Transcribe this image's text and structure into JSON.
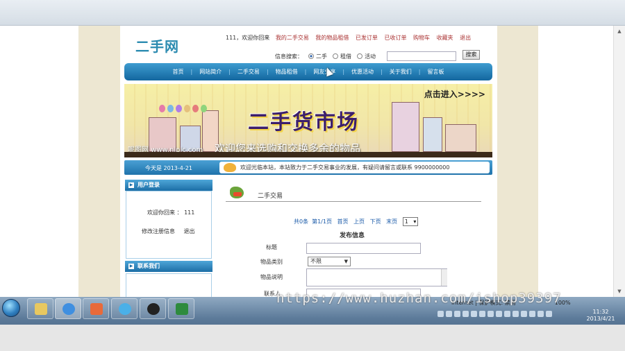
{
  "site": {
    "logo": "二手网",
    "top_links": {
      "welcome": "111，欢迎你回来",
      "items": [
        "我的二手交易",
        "我的物品租借",
        "已发订单",
        "已收订单",
        "购物车",
        "收藏夹",
        "退出"
      ]
    },
    "search": {
      "label": "信息搜索：",
      "options": [
        "二手",
        "租借",
        "活动"
      ],
      "selected": "二手",
      "button": "搜索"
    },
    "nav": [
      "首页",
      "网站简介",
      "二手交易",
      "物品租借",
      "网友分享",
      "优惠活动",
      "关于我们",
      "留言板"
    ],
    "banner": {
      "title": "二手货市场",
      "cta": "点击进入>>>>",
      "slogan": "欢迎您来选购和交换多余的物品",
      "credit": "呢图网 www.nipic.com"
    },
    "info_bar": {
      "date": "今天是 2013-4-21",
      "notice": "欢迎光临本站，本站致力于二手交易事业的发展，有疑问请留言或联系 9900000000"
    },
    "login_panel": {
      "title": "用户登录",
      "welcome": "欢迎你回来 ： 111",
      "links": [
        "修改注册信息",
        "退出"
      ]
    },
    "contact_panel": {
      "title": "联系我们"
    },
    "content": {
      "section_title": "二手交易",
      "pager": {
        "total": "共0条",
        "page": "第1/1页",
        "first": "首页",
        "prev": "上页",
        "next": "下页",
        "last": "末页",
        "select_value": "1"
      },
      "form_heading": "发布信息",
      "fields": {
        "title_label": "标题",
        "category_label": "物品类别",
        "category_value": "不限",
        "desc_label": "物品说明",
        "contact_label": "联系人"
      }
    }
  },
  "taskbar": {
    "time": "11:32",
    "date": "2013/4/21",
    "status": "Internet | 保护模式: 禁用",
    "zoom": "100%"
  },
  "watermark": "https://www.huzhan.com/ishop39397"
}
